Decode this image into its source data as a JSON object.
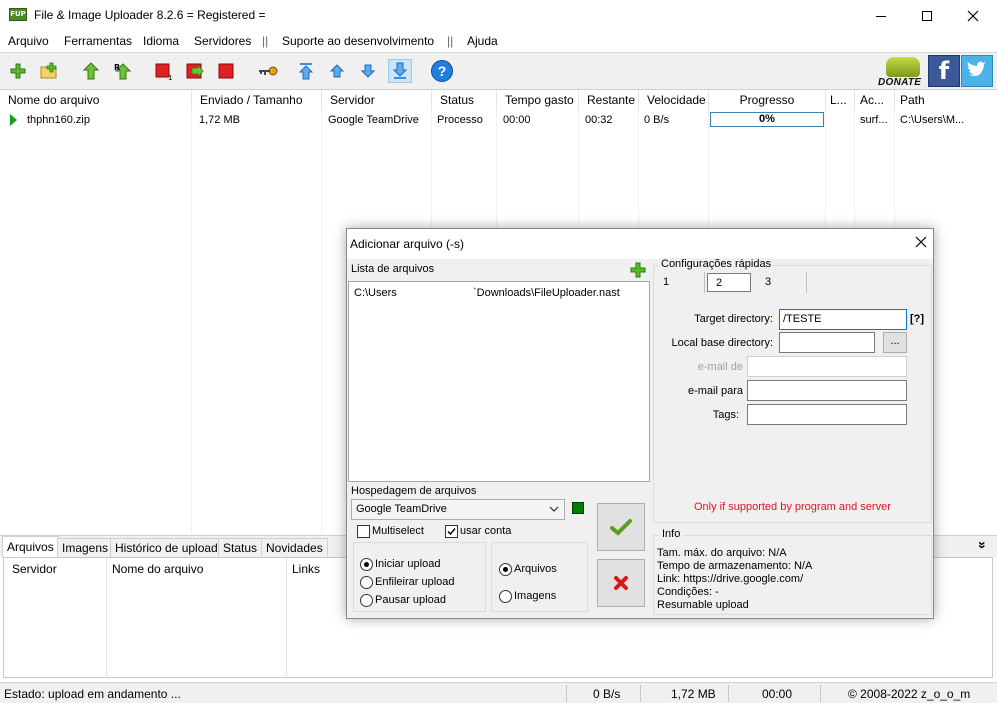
{
  "window": {
    "icon_text": "FUP",
    "title": "File & Image Uploader 8.2.6  = Registered ="
  },
  "menu": [
    "Arquivo",
    "Ferramentas",
    "Idioma",
    "Servidores",
    "||",
    "Suporte ao desenvolvimento",
    "||",
    "Ajuda"
  ],
  "toolbar": {
    "donate_label": "DONATE",
    "help_glyph": "?"
  },
  "list": {
    "columns": [
      "Nome do arquivo",
      "Enviado / Tamanho",
      "Servidor",
      "Status",
      "Tempo gasto",
      "Restante",
      "Velocidade",
      "Progresso",
      "L...",
      "Ac...",
      "Path"
    ],
    "rows": [
      {
        "name": "thphn160.zip",
        "sent_size": "1,72 MB",
        "server": "Google TeamDrive",
        "status": "Processo",
        "elapsed": "00:00",
        "remaining": "00:32",
        "speed": "0 B/s",
        "progress": "0%",
        "l": "",
        "ac": "surf...",
        "path": "C:\\Users\\M..."
      }
    ]
  },
  "bottom": {
    "tabs": [
      "Arquivos",
      "Imagens",
      "Histórico de uploads",
      "Status",
      "Novidades"
    ],
    "columns": [
      "Servidor",
      "Nome do arquivo",
      "Links"
    ],
    "collapse_glyph": "»"
  },
  "statusbar": {
    "state": "Estado: upload em andamento ...",
    "speed": "0 B/s",
    "size": "1,72 MB",
    "time": "00:00",
    "copyright": "© 2008-2022 z_o_o_m"
  },
  "dialog": {
    "title": "Adicionar arquivo (-s)",
    "file_list_label": "Lista de arquivos",
    "file_entry_user": "C:\\Users",
    "file_entry_path": "`Downloads\\FileUploader.nast",
    "hosting_label": "Hospedagem de arquivos",
    "hosting_value": "Google TeamDrive",
    "multiselect_label": "Multiselect",
    "use_account_label": "usar conta",
    "radio_start": "Iniciar upload",
    "radio_queue": "Enfileirar upload",
    "radio_pause": "Pausar upload",
    "radio_files": "Arquivos",
    "radio_images": "Imagens",
    "quick_settings_label": "Configurações rápidas",
    "quick_tabs": [
      "1",
      "2",
      "3"
    ],
    "target_dir_label": "Target directory:",
    "target_dir_value": "/TESTE",
    "target_dir_help": "[?]",
    "local_base_label": "Local base directory:",
    "local_base_value": "",
    "browse_label": "...",
    "email_from_label": "e-mail de",
    "email_to_label": "e-mail para",
    "tags_label": "Tags:",
    "support_note": "Only if supported by program and server",
    "info_label": "Info",
    "info_lines": [
      "Tam. máx. do arquivo: N/A",
      "Tempo de armazenamento: N/A",
      "Link: https://drive.google.com/",
      "Condições: -",
      "Resumable upload"
    ],
    "colors": {
      "note": "#e81123",
      "help_link": "#0033aa",
      "server_ok": "#008000"
    }
  }
}
